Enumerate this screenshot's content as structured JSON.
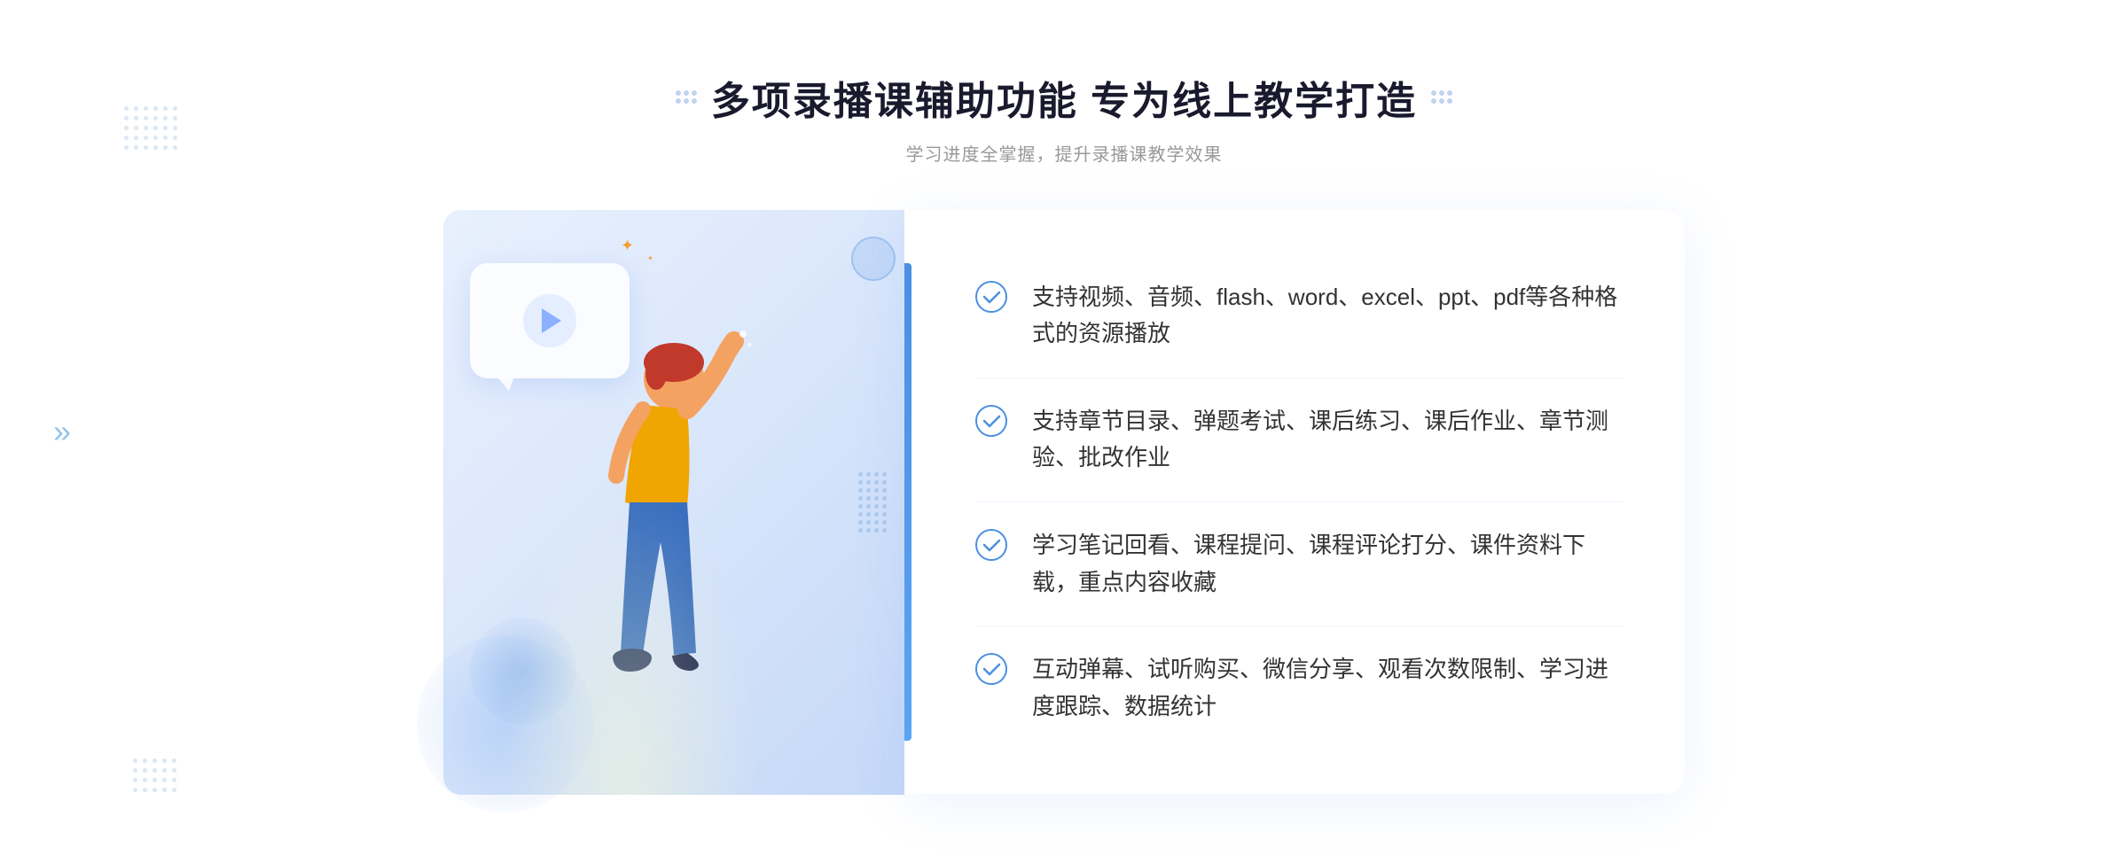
{
  "page": {
    "background_color": "#ffffff"
  },
  "header": {
    "title": "多项录播课辅助功能 专为线上教学打造",
    "subtitle": "学习进度全掌握，提升录播课教学效果",
    "dots_decoration": true
  },
  "features": [
    {
      "id": 1,
      "text": "支持视频、音频、flash、word、excel、ppt、pdf等各种格式的资源播放"
    },
    {
      "id": 2,
      "text": "支持章节目录、弹题考试、课后练习、课后作业、章节测验、批改作业"
    },
    {
      "id": 3,
      "text": "学习笔记回看、课程提问、课程评论打分、课件资料下载，重点内容收藏"
    },
    {
      "id": 4,
      "text": "互动弹幕、试听购买、微信分享、观看次数限制、学习进度跟踪、数据统计"
    }
  ],
  "illustration": {
    "play_button": "▶",
    "accent_color": "#4a90e2",
    "bg_gradient_start": "#e8f0fd",
    "bg_gradient_end": "#c5d8f8"
  },
  "decorations": {
    "chevron_left": "»",
    "sparkle": "✦"
  }
}
